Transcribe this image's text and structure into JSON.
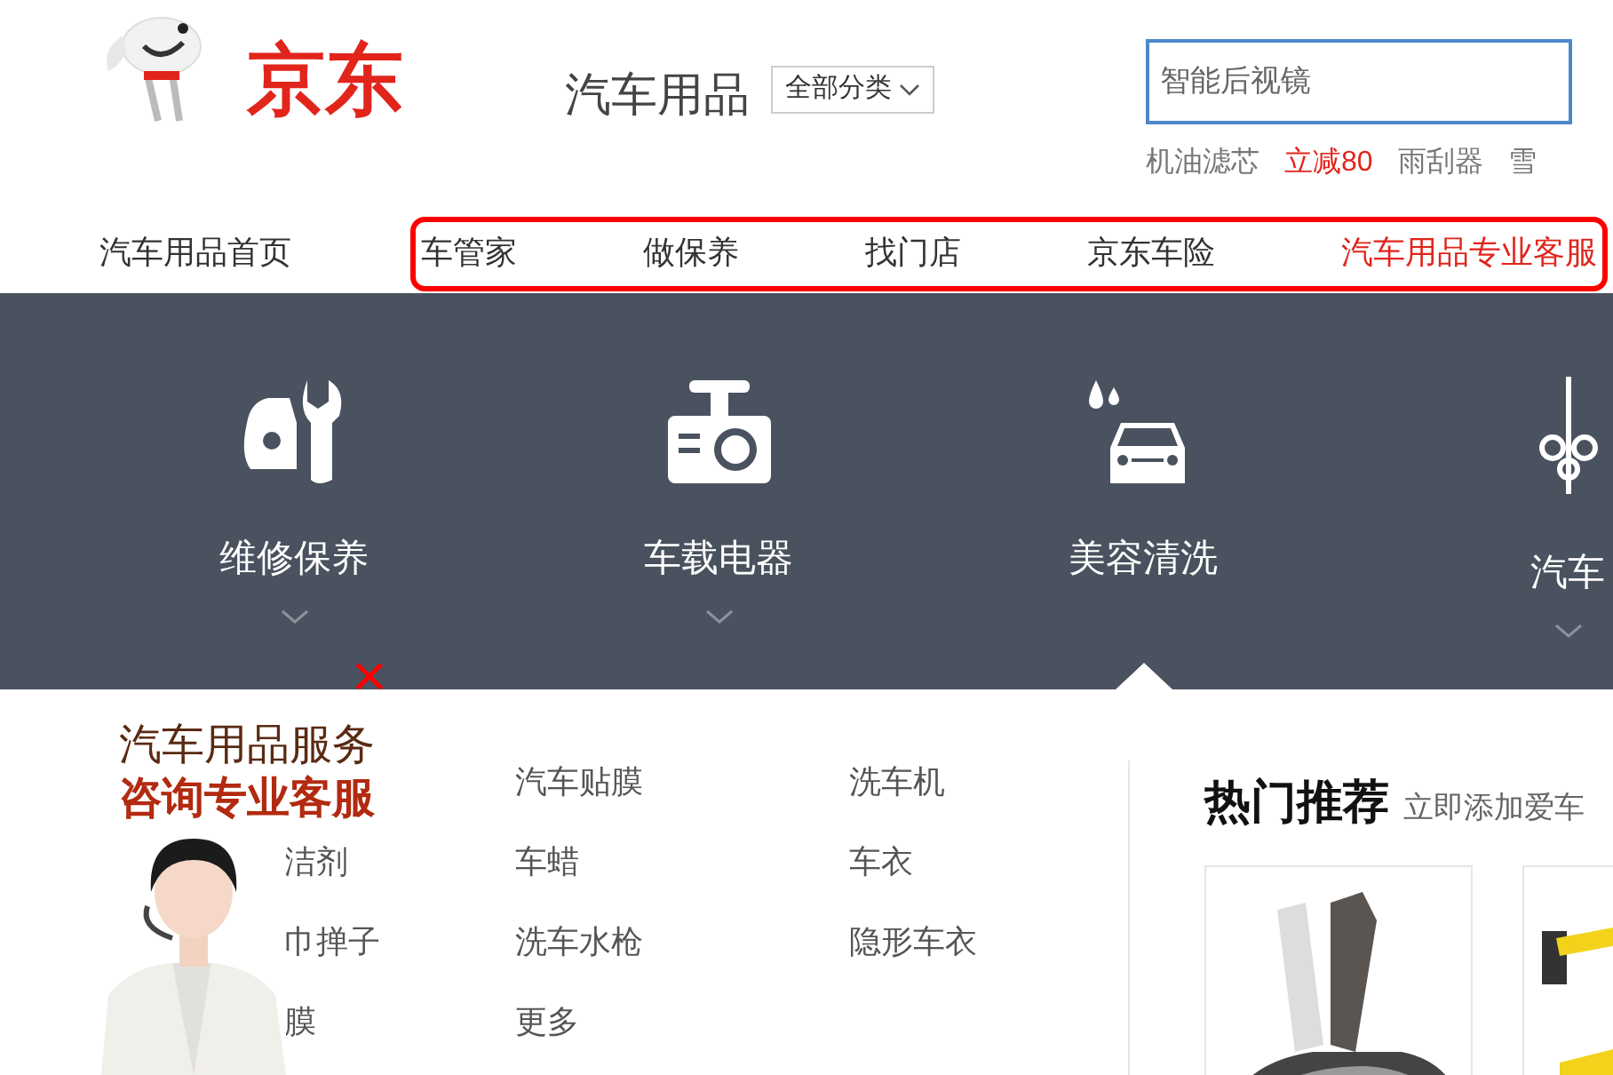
{
  "header": {
    "logo_text": "京东",
    "channel_title": "汽车用品",
    "category_dropdown": "全部分类",
    "search": {
      "placeholder": "智能后视镜"
    },
    "hot_keywords": [
      {
        "label": "机油滤芯",
        "highlight": false
      },
      {
        "label": "立减80",
        "highlight": true
      },
      {
        "label": "雨刮器",
        "highlight": false
      },
      {
        "label": "雪",
        "highlight": false
      }
    ]
  },
  "nav": {
    "home": "汽车用品首页",
    "items": [
      {
        "label": "车管家",
        "highlight": false
      },
      {
        "label": "做保养",
        "highlight": false
      },
      {
        "label": "找门店",
        "highlight": false
      },
      {
        "label": "京东车险",
        "highlight": false
      },
      {
        "label": "汽车用品专业客服",
        "highlight": true
      }
    ]
  },
  "categories": [
    {
      "kind": "repair",
      "label": "维修保养",
      "selected": false
    },
    {
      "kind": "electronics",
      "label": "车载电器",
      "selected": false
    },
    {
      "kind": "wash",
      "label": "美容清洗",
      "selected": true
    },
    {
      "kind": "decor",
      "label": "汽车",
      "selected": false
    }
  ],
  "submenu": {
    "columns": [
      [
        "洁剂",
        "巾掸子",
        "膜"
      ],
      [
        "汽车贴膜",
        "车蜡",
        "洗车水枪",
        "更多"
      ],
      [
        "洗车机",
        "车衣",
        "隐形车衣"
      ]
    ]
  },
  "hot": {
    "title": "热门推荐",
    "subtitle": "立即添加爱车"
  },
  "service_widget": {
    "line1": "汽车用品服务",
    "line2": "咨询专业客服",
    "close": "×"
  }
}
